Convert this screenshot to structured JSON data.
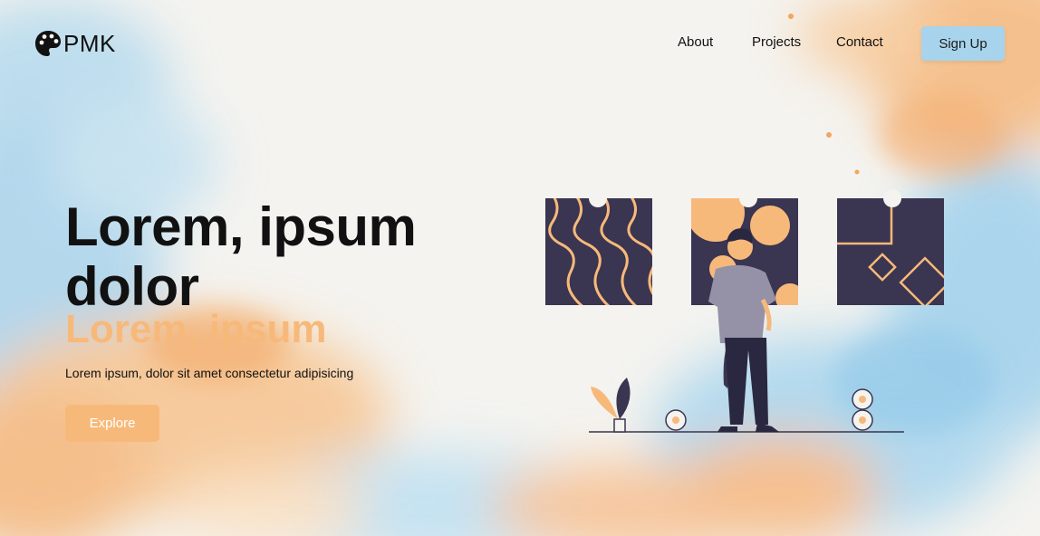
{
  "brand": {
    "name": "PMK",
    "logo_icon": "palette-icon"
  },
  "nav": {
    "items": [
      {
        "label": "About"
      },
      {
        "label": "Projects"
      },
      {
        "label": "Contact"
      }
    ],
    "signup_label": "Sign Up"
  },
  "hero": {
    "title": "Lorem, ipsum dolor",
    "subtitle": "Lorem, ipsum",
    "lead": "Lorem ipsum, dolor sit amet consectetur adipisicing",
    "cta_label": "Explore"
  },
  "colors": {
    "accent_orange": "#f7b97a",
    "accent_blue": "#a7d4ec",
    "dark_navy": "#3a3550",
    "text": "#111111"
  },
  "illustration": {
    "name": "person-viewing-art-gallery"
  }
}
